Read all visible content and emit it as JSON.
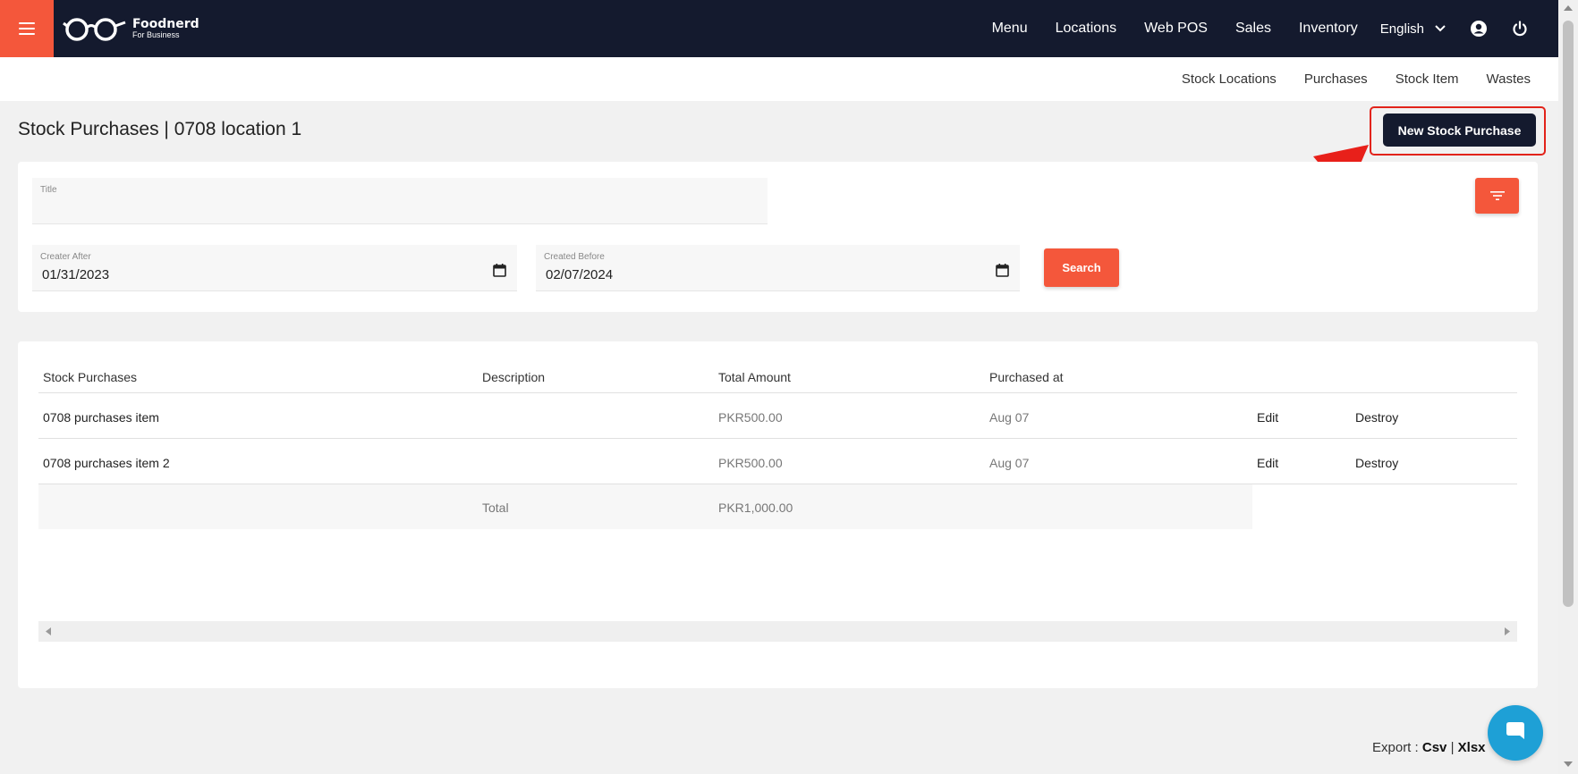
{
  "brand": {
    "name": "Foodnerd",
    "tagline": "For Business"
  },
  "nav": {
    "items": [
      "Menu",
      "Locations",
      "Web POS",
      "Sales",
      "Inventory"
    ],
    "language": "English"
  },
  "subnav": {
    "items": [
      "Stock Locations",
      "Purchases",
      "Stock Item",
      "Wastes"
    ]
  },
  "page": {
    "title": "Stock Purchases | 0708 location 1",
    "new_button": "New Stock Purchase"
  },
  "filters": {
    "title_label": "Title",
    "title_value": "",
    "after_label": "Creater After",
    "after_value": "01/31/2023",
    "before_label": "Created Before",
    "before_value": "02/07/2024",
    "search_label": "Search"
  },
  "table": {
    "headers": [
      "Stock Purchases",
      "Description",
      "Total Amount",
      "Purchased at"
    ],
    "rows": [
      {
        "name": "0708 purchases item",
        "description": "",
        "amount": "PKR500.00",
        "date": "Aug 07",
        "edit": "Edit",
        "destroy": "Destroy"
      },
      {
        "name": "0708 purchases item 2",
        "description": "",
        "amount": "PKR500.00",
        "date": "Aug 07",
        "edit": "Edit",
        "destroy": "Destroy"
      }
    ],
    "total_label": "Total",
    "total_value": "PKR1,000.00"
  },
  "export": {
    "label": "Export",
    "csv": "Csv",
    "xlsx": "Xlsx"
  },
  "colors": {
    "navy": "#141a2e",
    "accent": "#f4573b",
    "highlight": "#e2231a",
    "chat": "#1ea0d6"
  }
}
